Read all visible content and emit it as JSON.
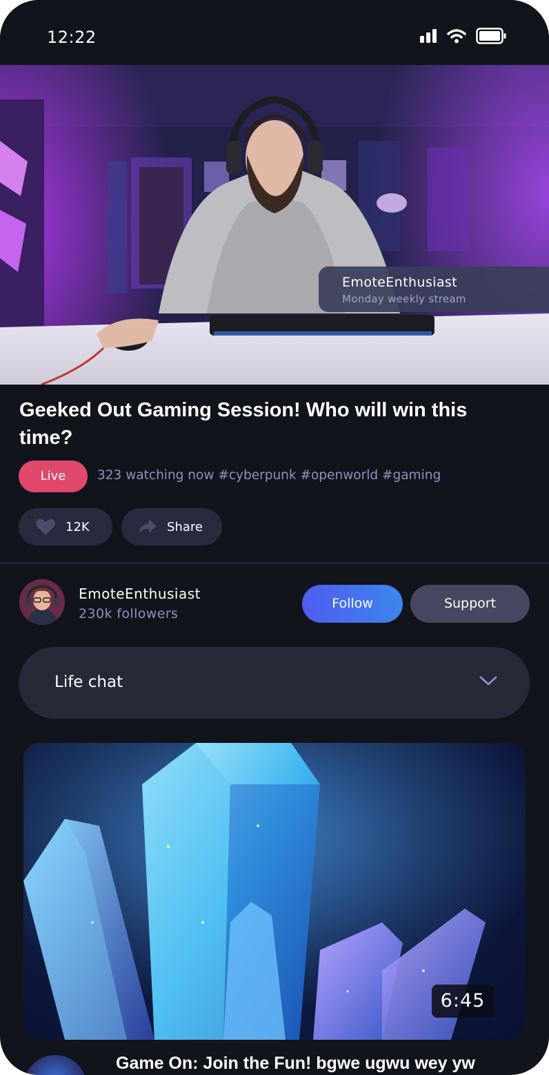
{
  "status_bar": {
    "time": "12:22",
    "icons": [
      "signal-icon",
      "wifi-icon",
      "battery-icon"
    ]
  },
  "hero": {
    "overlay": {
      "name": "EmoteEnthusiast",
      "subtitle": "Monday weekly stream"
    }
  },
  "stream": {
    "title": "Geeked Out Gaming Session! Who will win this time?",
    "live_label": "Live",
    "watching_text": "323 watching now #cyberpunk #openworld #gaming",
    "likes": "12K",
    "share_label": "Share"
  },
  "channel": {
    "name": "EmoteEnthusiast",
    "followers": "230k followers",
    "follow_label": "Follow",
    "support_label": "Support"
  },
  "chat": {
    "label": "Life chat"
  },
  "next_video": {
    "duration": "6:45",
    "title": "Game On: Join the Fun! bgwe  ugwu wey yw"
  },
  "colors": {
    "background": "#12141b",
    "live": "#e0486c",
    "accent_start": "#4f5cf0",
    "accent_end": "#3c86ee",
    "muted_text": "#8f92c2",
    "surface": "#272939"
  }
}
